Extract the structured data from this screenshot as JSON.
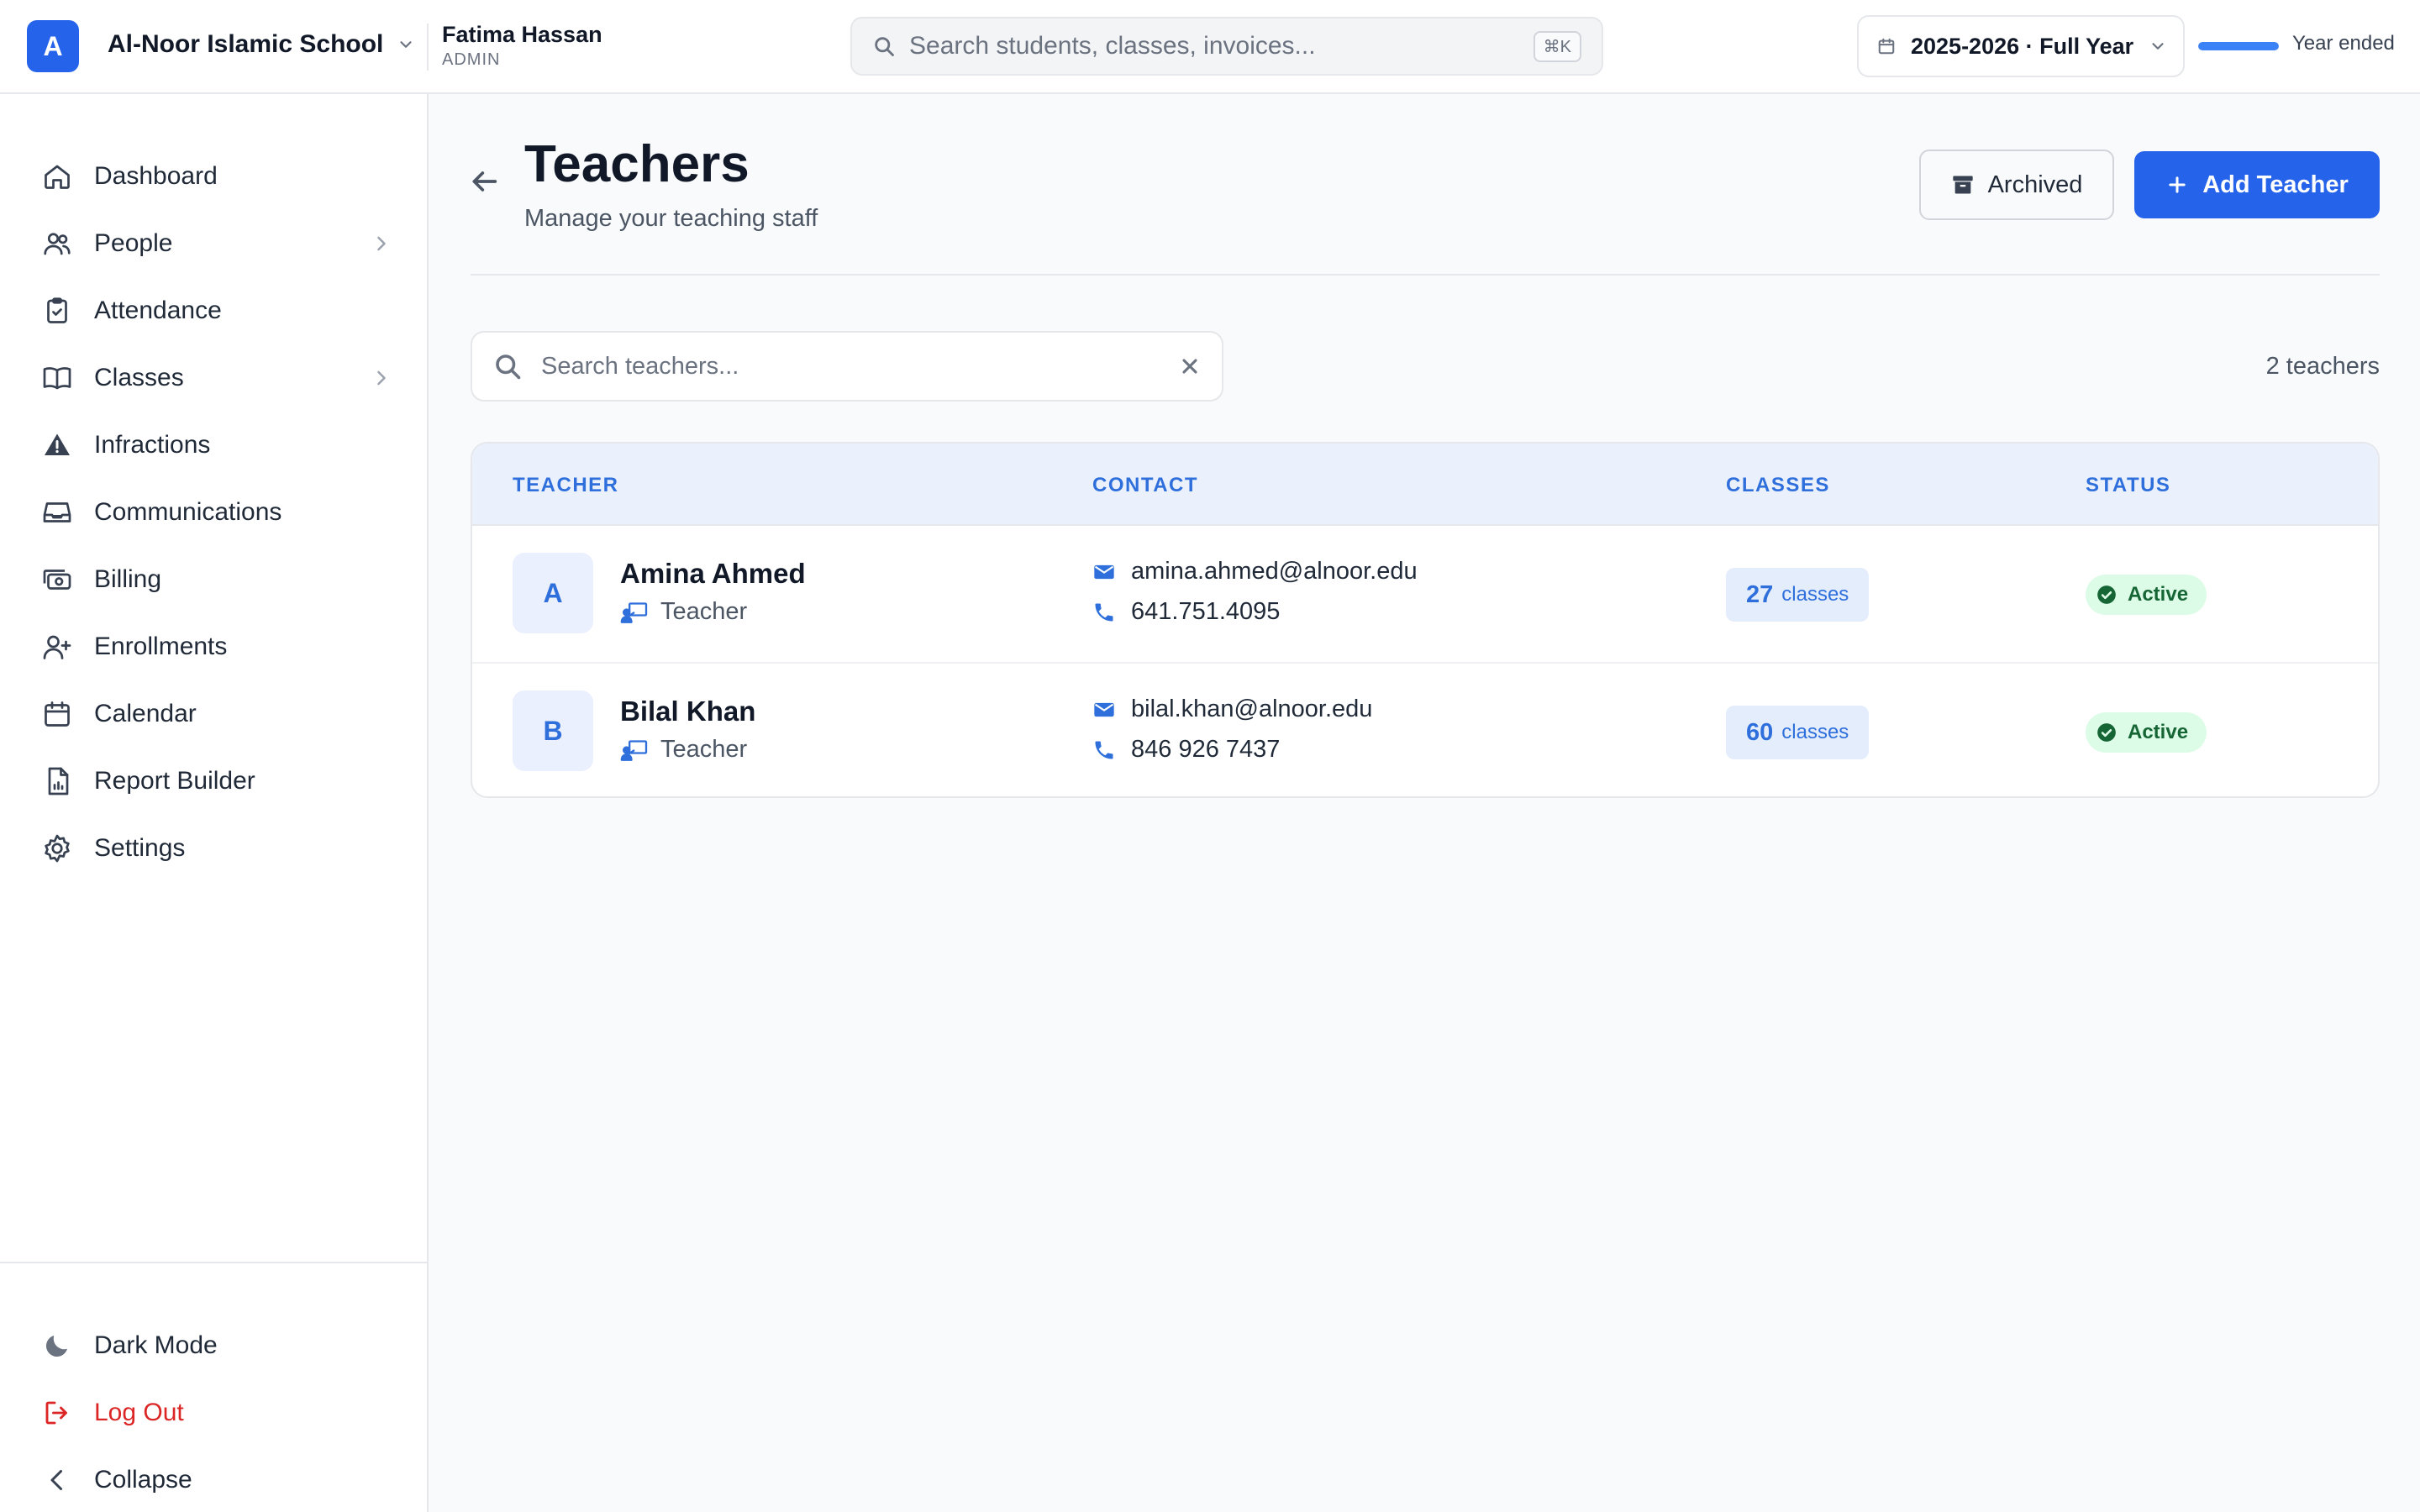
{
  "header": {
    "logo_letter": "A",
    "school_name": "Al-Noor Islamic School",
    "user_name": "Fatima Hassan",
    "user_role": "ADMIN",
    "search_placeholder": "Search students, classes, invoices...",
    "search_shortcut": "⌘K",
    "academic_year": "2025-2026 · Full Year",
    "year_progress": 1.0,
    "year_status": "Year ended"
  },
  "sidebar": {
    "items": [
      {
        "label": "Dashboard",
        "icon": "home-icon"
      },
      {
        "label": "People",
        "icon": "users-icon",
        "has_children": true
      },
      {
        "label": "Attendance",
        "icon": "clipboard-check-icon"
      },
      {
        "label": "Classes",
        "icon": "book-open-icon",
        "has_children": true
      },
      {
        "label": "Infractions",
        "icon": "warning-icon"
      },
      {
        "label": "Communications",
        "icon": "inbox-icon"
      },
      {
        "label": "Billing",
        "icon": "cash-icon"
      },
      {
        "label": "Enrollments",
        "icon": "user-plus-icon"
      },
      {
        "label": "Calendar",
        "icon": "calendar-icon"
      },
      {
        "label": "Report Builder",
        "icon": "report-icon"
      },
      {
        "label": "Settings",
        "icon": "gear-icon"
      }
    ],
    "footer": {
      "dark_mode": "Dark Mode",
      "logout": "Log Out",
      "collapse": "Collapse"
    }
  },
  "page": {
    "title": "Teachers",
    "subtitle": "Manage your teaching staff",
    "archived_label": "Archived",
    "add_label": "Add Teacher",
    "search_placeholder": "Search teachers...",
    "count_text": "2 teachers"
  },
  "table": {
    "columns": [
      "TEACHER",
      "CONTACT",
      "CLASSES",
      "STATUS"
    ],
    "rows": [
      {
        "initial": "A",
        "name": "Amina Ahmed",
        "role": "Teacher",
        "email": "amina.ahmed@alnoor.edu",
        "phone": "641.751.4095",
        "class_count": "27",
        "class_label": "classes",
        "status": "Active"
      },
      {
        "initial": "B",
        "name": "Bilal Khan",
        "role": "Teacher",
        "email": "bilal.khan@alnoor.edu",
        "phone": "846 926 7437",
        "class_count": "60",
        "class_label": "classes",
        "status": "Active"
      }
    ]
  },
  "colors": {
    "accent": "#2563eb",
    "header_text": "#2f6fdc",
    "active_bg": "#dcfce7",
    "active_text": "#166534",
    "logout": "#dc2626"
  }
}
